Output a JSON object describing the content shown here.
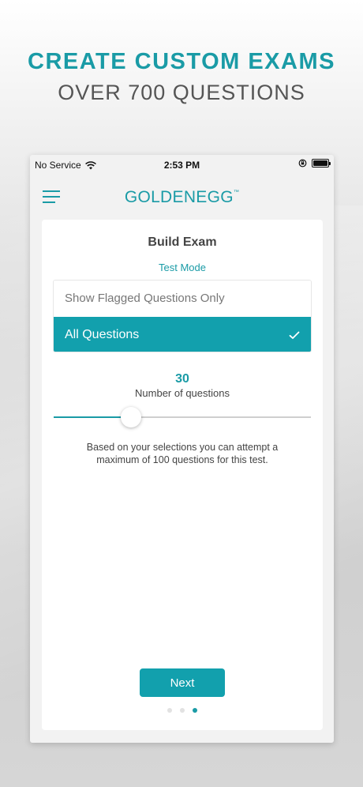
{
  "promo": {
    "headline": "CREATE CUSTOM EXAMS",
    "subheadline": "OVER 700 QUESTIONS"
  },
  "statusbar": {
    "carrier": "No Service",
    "time": "2:53 PM",
    "icons": [
      "wifi-icon",
      "orientation-lock-icon",
      "battery-icon"
    ],
    "battery_level": 1.0
  },
  "navbar": {
    "menu_icon": "hamburger-menu-icon",
    "logo_text": "GOLDENEGG",
    "logo_mark": "™"
  },
  "build_exam": {
    "title": "Build Exam",
    "mode": "Test Mode",
    "options": [
      {
        "label": "Show Flagged Questions Only",
        "selected": false
      },
      {
        "label": "All Questions",
        "selected": true,
        "check_icon": "checkmark-icon"
      }
    ],
    "question_count": "30",
    "question_count_label": "Number of questions",
    "slider": {
      "min": 0,
      "max": 100,
      "value": 30
    },
    "info": "Based on your selections you can attempt a maximum of 100 questions for this test.",
    "next_label": "Next"
  },
  "pagination": {
    "total": 3,
    "current": 3
  },
  "colors": {
    "accent": "#1a9ba6",
    "selected_bg": "#12a0ad",
    "headline": "#1a9ba6",
    "subheadline": "#555555"
  }
}
